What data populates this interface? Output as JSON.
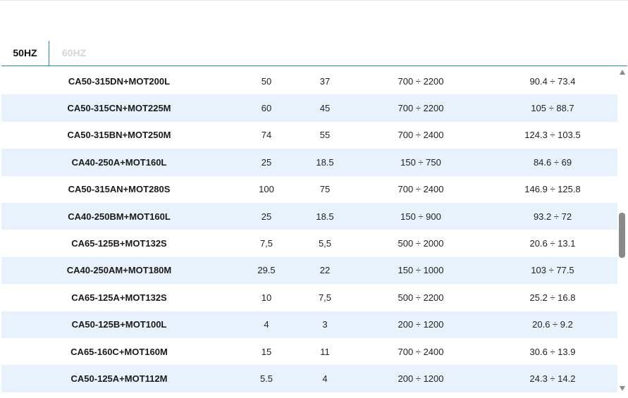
{
  "tabs": [
    {
      "label": "50HZ",
      "active": true
    },
    {
      "label": "60HZ",
      "active": false
    }
  ],
  "colors": {
    "accent": "#1f8fb0",
    "row_stripe": "#e7f2fc",
    "inactive_tab": "#d6d6d6"
  },
  "table": {
    "rows": [
      [
        "CA50-315DN+MOT200L",
        "50",
        "37",
        "700 ÷ 2200",
        "90.4 ÷ 73.4"
      ],
      [
        "CA50-315CN+MOT225M",
        "60",
        "45",
        "700 ÷ 2200",
        "105 ÷ 88.7"
      ],
      [
        "CA50-315BN+MOT250M",
        "74",
        "55",
        "700 ÷ 2400",
        "124.3 ÷ 103.5"
      ],
      [
        "CA40-250A+MOT160L",
        "25",
        "18.5",
        "150 ÷ 750",
        "84.6 ÷ 69"
      ],
      [
        "CA50-315AN+MOT280S",
        "100",
        "75",
        "700 ÷ 2400",
        "146.9 ÷ 125.8"
      ],
      [
        "CA40-250BM+MOT160L",
        "25",
        "18.5",
        "150 ÷ 900",
        "93.2 ÷ 72"
      ],
      [
        "CA65-125B+MOT132S",
        "7,5",
        "5,5",
        "500 ÷ 2000",
        "20.6 ÷ 13.1"
      ],
      [
        "CA40-250AM+MOT180M",
        "29.5",
        "22",
        "150 ÷ 1000",
        "103 ÷ 77.5"
      ],
      [
        "CA65-125A+MOT132S",
        "10",
        "7,5",
        "500 ÷ 2200",
        "25.2 ÷ 16.8"
      ],
      [
        "CA50-125B+MOT100L",
        "4",
        "3",
        "200 ÷ 1200",
        "20.6 ÷ 9.2"
      ],
      [
        "CA65-160C+MOT160M",
        "15",
        "11",
        "700 ÷ 2400",
        "30.6 ÷ 13.9"
      ],
      [
        "CA50-125A+MOT112M",
        "5.5",
        "4",
        "200 ÷ 1200",
        "24.3 ÷ 14.2"
      ]
    ]
  },
  "scrollbar": {
    "icons": [
      "scroll-up-arrow-icon",
      "scroll-down-arrow-icon"
    ]
  }
}
